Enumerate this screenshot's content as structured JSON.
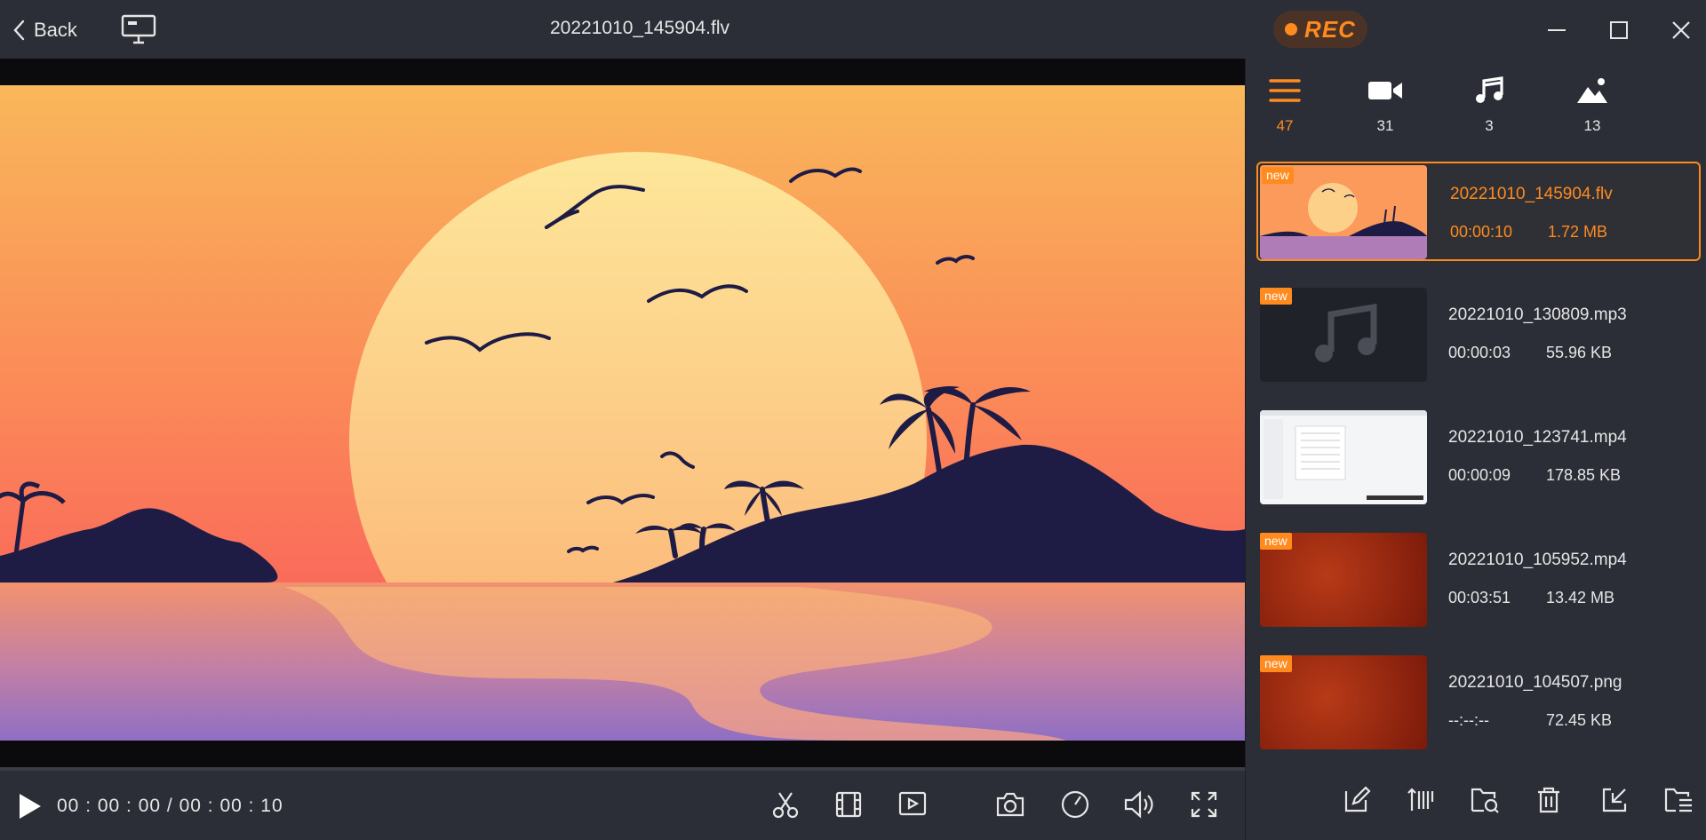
{
  "header": {
    "back_label": "Back",
    "title": "20221010_145904.flv",
    "rec_label": "REC"
  },
  "colors": {
    "accent": "#ff8a1e",
    "background": "#2b2e36"
  },
  "player": {
    "time": "00 : 00 : 00 / 00 : 00 : 10",
    "progress": 0
  },
  "filters": [
    {
      "icon": "list-icon",
      "count": "47",
      "active": true
    },
    {
      "icon": "video-icon",
      "count": "31"
    },
    {
      "icon": "music-icon",
      "count": "3"
    },
    {
      "icon": "image-icon",
      "count": "13"
    }
  ],
  "files": [
    {
      "name": "20221010_145904.flv",
      "duration": "00:00:10",
      "size": "1.72 MB",
      "badge": "new",
      "thumb": "sunset",
      "selected": true
    },
    {
      "name": "20221010_130809.mp3",
      "duration": "00:00:03",
      "size": "55.96 KB",
      "badge": "new",
      "thumb": "audio"
    },
    {
      "name": "20221010_123741.mp4",
      "duration": "00:00:09",
      "size": "178.85 KB",
      "thumb": "screen"
    },
    {
      "name": "20221010_105952.mp4",
      "duration": "00:03:51",
      "size": "13.42 MB",
      "badge": "new",
      "thumb": "red"
    },
    {
      "name": "20221010_104507.png",
      "duration": "--:--:--",
      "size": "72.45 KB",
      "badge": "new",
      "thumb": "red"
    }
  ]
}
